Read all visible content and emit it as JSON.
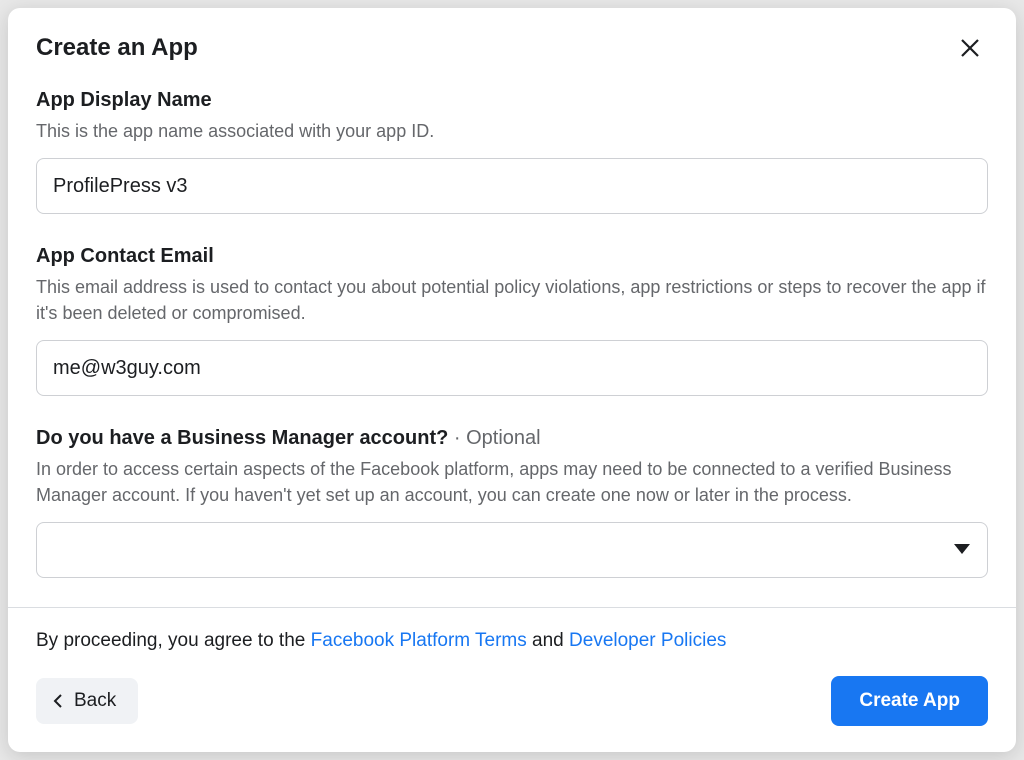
{
  "modal": {
    "title": "Create an App"
  },
  "appName": {
    "label": "App Display Name",
    "description": "This is the app name associated with your app ID.",
    "value": "ProfilePress v3"
  },
  "contactEmail": {
    "label": "App Contact Email",
    "description": "This email address is used to contact you about potential policy violations, app restrictions or steps to recover the app if it's been deleted or compromised.",
    "value": "me@w3guy.com"
  },
  "businessManager": {
    "label": "Do you have a Business Manager account?",
    "optional": " · Optional",
    "description": "In order to access certain aspects of the Facebook platform, apps may need to be connected to a verified Business Manager account. If you haven't yet set up an account, you can create one now or later in the process.",
    "value": ""
  },
  "footer": {
    "termsPrefix": "By proceeding, you agree to the ",
    "termsLink1": "Facebook Platform Terms",
    "termsAnd": " and ",
    "termsLink2": "Developer Policies",
    "backLabel": "Back",
    "createLabel": "Create App"
  }
}
